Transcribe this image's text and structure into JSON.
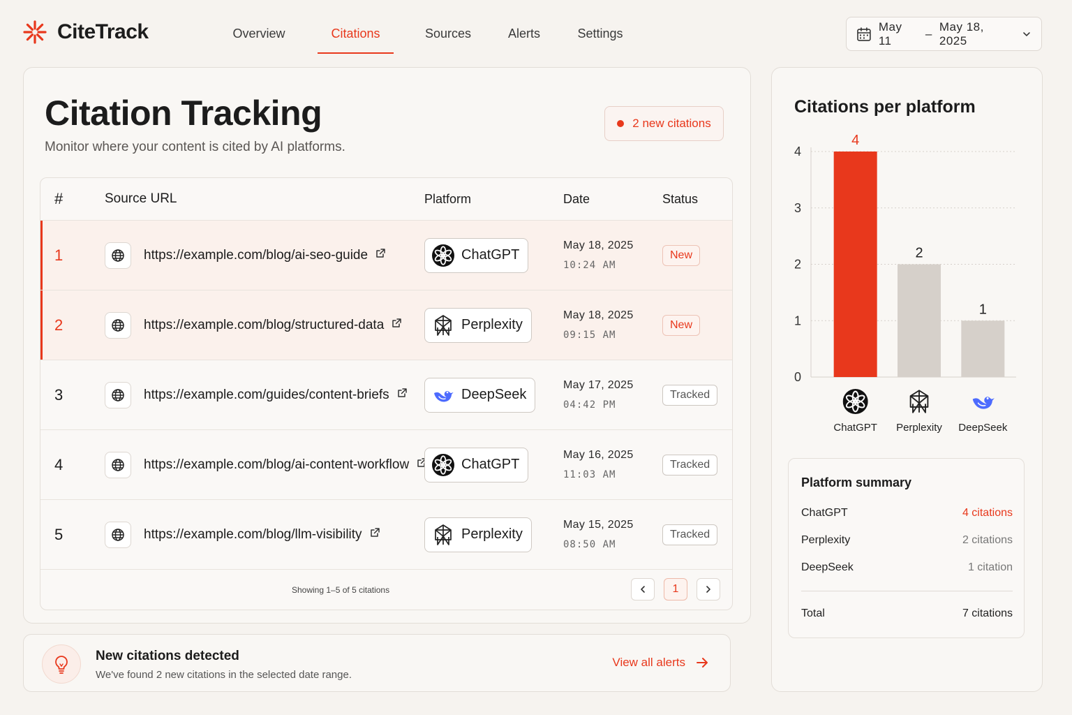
{
  "app": {
    "name": "CiteTrack"
  },
  "nav": {
    "items": [
      {
        "label": "Overview",
        "active": false
      },
      {
        "label": "Citations",
        "active": true
      },
      {
        "label": "Sources",
        "active": false
      },
      {
        "label": "Alerts",
        "active": false
      },
      {
        "label": "Settings",
        "active": false
      }
    ]
  },
  "date_range": {
    "start": "May 11",
    "separator": "–",
    "end": "May 18, 2025"
  },
  "page": {
    "title": "Citation Tracking",
    "subtitle": "Monitor where your content is cited by AI platforms.",
    "new_badge": "2 new citations"
  },
  "table": {
    "headers": {
      "num": "#",
      "url": "Source URL",
      "platform": "Platform",
      "date": "Date",
      "status": "Status"
    },
    "rows": [
      {
        "num": "1",
        "url": "https://example.com/blog/ai-seo-guide",
        "platform": "ChatGPT",
        "date": "May 18, 2025",
        "time": "10:24 AM",
        "status": "New"
      },
      {
        "num": "2",
        "url": "https://example.com/blog/structured-data",
        "platform": "Perplexity",
        "date": "May 18, 2025",
        "time": "09:15 AM",
        "status": "New"
      },
      {
        "num": "3",
        "url": "https://example.com/guides/content-briefs",
        "platform": "DeepSeek",
        "date": "May 17, 2025",
        "time": "04:42 PM",
        "status": "Tracked"
      },
      {
        "num": "4",
        "url": "https://example.com/blog/ai-content-workflow",
        "platform": "ChatGPT",
        "date": "May 16, 2025",
        "time": "11:03 AM",
        "status": "Tracked"
      },
      {
        "num": "5",
        "url": "https://example.com/blog/llm-visibility",
        "platform": "Perplexity",
        "date": "May 15, 2025",
        "time": "08:50 AM",
        "status": "Tracked"
      }
    ],
    "footer": {
      "showing": "Showing 1–5 of 5 citations",
      "current_page": "1"
    }
  },
  "alert": {
    "title": "New citations detected",
    "text_prefix": "We've found",
    "count": "2",
    "text_suffix": "new citations in the selected date range.",
    "link": "View all alerts"
  },
  "side": {
    "title": "Citations per platform",
    "summary": {
      "title": "Platform summary",
      "rows": [
        {
          "name": "ChatGPT",
          "value": "4 citations"
        },
        {
          "name": "Perplexity",
          "value": "2 citations"
        },
        {
          "name": "DeepSeek",
          "value": "1 citation"
        }
      ],
      "total_label": "Total",
      "total_value": "7 citations"
    }
  },
  "colors": {
    "accent": "#e8381c",
    "bar_muted": "#d6d0ca",
    "deepseek": "#4d6bfe"
  },
  "chart_data": {
    "type": "bar",
    "categories": [
      "ChatGPT",
      "Perplexity",
      "DeepSeek"
    ],
    "values": [
      4,
      2,
      1
    ],
    "title": "Citations per platform",
    "xlabel": "",
    "ylabel": "",
    "ylim": [
      0,
      4
    ],
    "yticks": [
      0,
      1,
      2,
      3,
      4
    ],
    "grid": true,
    "highlight": "ChatGPT"
  }
}
